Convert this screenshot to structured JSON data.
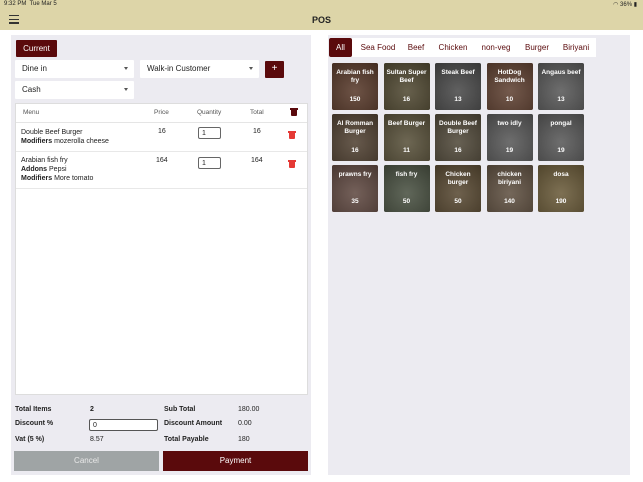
{
  "status": {
    "time": "9:32 PM",
    "date": "Tue Mar 5",
    "battery": "36%"
  },
  "nav": {
    "title": "POS"
  },
  "left": {
    "current_label": "Current",
    "order_type": "Dine in",
    "customer": "Walk-in Customer",
    "add_symbol": "+",
    "payment_method": "Cash",
    "table_headers": {
      "menu": "Menu",
      "price": "Price",
      "quantity": "Quantity",
      "total": "Total"
    },
    "items": [
      {
        "name": "Double Beef Burger",
        "modifiers_label": "Modifiers",
        "modifiers": "mozerolla cheese",
        "price": "16",
        "qty": "1",
        "total": "16"
      },
      {
        "name": "Arabian fish fry",
        "addons_label": "Addons",
        "addons": "Pepsi",
        "modifiers_label": "Modifiers",
        "modifiers": "More tomato",
        "price": "164",
        "qty": "1",
        "total": "164"
      }
    ],
    "summary": {
      "total_items_label": "Total Items",
      "total_items": "2",
      "sub_total_label": "Sub Total",
      "sub_total": "180.00",
      "discount_label": "Discount %",
      "discount_value": "0",
      "discount_amount_label": "Discount Amount",
      "discount_amount": "0.00",
      "vat_label": "Vat (5 %)",
      "vat": "8.57",
      "payable_label": "Total Payable",
      "payable": "180"
    },
    "cancel_label": "Cancel",
    "payment_label": "Payment"
  },
  "categories": [
    "All",
    "Sea Food",
    "Beef",
    "Chicken",
    "non-veg",
    "Burger",
    "Biriyani"
  ],
  "products": [
    {
      "name": "Arabian fish fry",
      "price": "150",
      "color": "#8a4a2a"
    },
    {
      "name": "Sultan Super Beef",
      "price": "16",
      "color": "#7a6a3a"
    },
    {
      "name": "Steak Beef",
      "price": "13",
      "color": "#6a6a6a"
    },
    {
      "name": "HotDog Sandwich",
      "price": "10",
      "color": "#9a5a3a"
    },
    {
      "name": "Angaus beef",
      "price": "13",
      "color": "#8a8a8a"
    },
    {
      "name": "Al Romman Burger",
      "price": "16",
      "color": "#7a5a3a"
    },
    {
      "name": "Beef Burger",
      "price": "11",
      "color": "#8a7a4a"
    },
    {
      "name": "Double Beef Burger",
      "price": "16",
      "color": "#7a6a4a"
    },
    {
      "name": "two idly",
      "price": "19",
      "color": "#8a8a8a"
    },
    {
      "name": "pongal",
      "price": "19",
      "color": "#8a8a8a"
    },
    {
      "name": "prawns fry",
      "price": "35",
      "color": "#9a6a5a"
    },
    {
      "name": "fish fry",
      "price": "50",
      "color": "#6a7a5a"
    },
    {
      "name": "Chicken burger",
      "price": "50",
      "color": "#8a6a3a"
    },
    {
      "name": "chicken biriyani",
      "price": "140",
      "color": "#9a7a5a"
    },
    {
      "name": "dosa",
      "price": "190",
      "color": "#b0904a"
    }
  ]
}
